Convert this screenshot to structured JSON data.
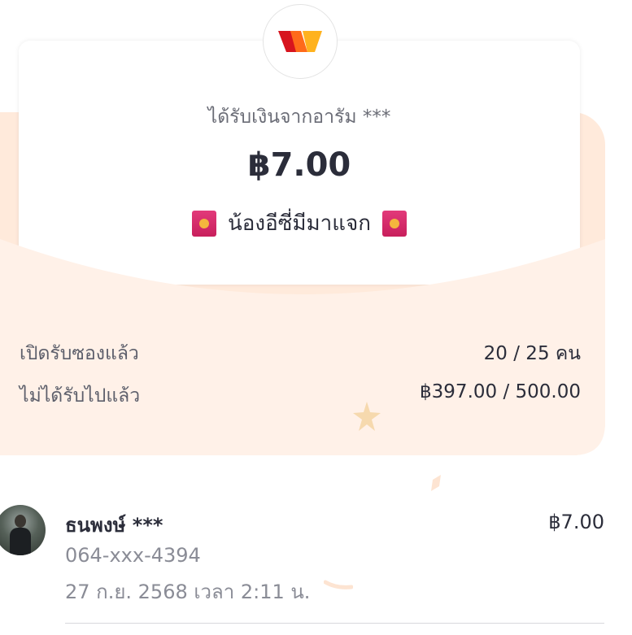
{
  "envelope": {
    "sender_line": "ได้รับเงินจากอารัม ***",
    "amount": "฿7.00",
    "message": "น้องอีซี่มีมาแจก"
  },
  "stats": {
    "opened": {
      "label": "เปิดรับซองแล้ว",
      "value": "20 / 25 คน"
    },
    "remaining": {
      "label": "ไม่ได้รับไปแล้ว",
      "value": "฿397.00 / 500.00"
    }
  },
  "recipients": [
    {
      "name": "ธนพงษ์ ***",
      "amount": "฿7.00",
      "phone": "064-xxx-4394",
      "time": "27 ก.ย. 2568 เวลา 2:11 น."
    }
  ],
  "colors": {
    "envelope_back": "#ffeadb",
    "flap": "#fff1e8",
    "red_envelope_icon": "#d42a6a",
    "text_primary": "#2b2d3a",
    "text_muted": "#8a8c96",
    "star": "#f6d9ae"
  },
  "icons": {
    "logo": "wallet-w-logo-icon",
    "message_decoration": "red-envelope-icon"
  }
}
